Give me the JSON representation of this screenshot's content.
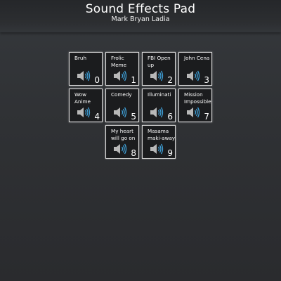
{
  "header": {
    "title": "Sound Effects Pad",
    "subtitle": "Mark Bryan Ladia"
  },
  "pads": [
    {
      "label": "Bruh",
      "key": "0"
    },
    {
      "label": "Frolic Meme",
      "key": "1"
    },
    {
      "label": "FBI Open up",
      "key": "2"
    },
    {
      "label": "John Cena",
      "key": "3"
    },
    {
      "label": "Wow Anime",
      "key": "4"
    },
    {
      "label": "Comedy",
      "key": "5"
    },
    {
      "label": "Illuminati",
      "key": "6"
    },
    {
      "label": "Mission Impossible",
      "key": "7"
    },
    {
      "label": "My heart will go on",
      "key": "8"
    },
    {
      "label": "Masama maki-away",
      "key": "9"
    }
  ],
  "colors": {
    "speaker_body": "#b8b8b8",
    "speaker_waves": "#3fa0d8"
  },
  "icon": "speaker-icon"
}
